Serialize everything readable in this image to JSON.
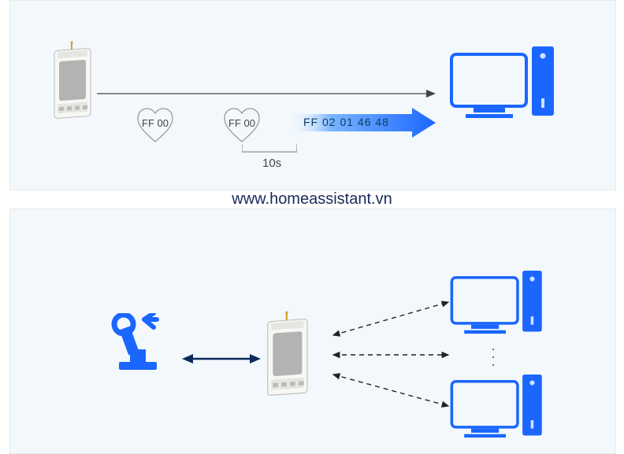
{
  "watermark": "www.homeassistant.vn",
  "diagram_top": {
    "heart1_label": "FF 00",
    "heart2_label": "FF 00",
    "timing_label": "10s",
    "packet": "FF 02 01 46 48"
  },
  "colors": {
    "accent_blue": "#1a66ff",
    "device_gray": "#b0b0b0",
    "arrow_navy": "#0b2b5b"
  }
}
